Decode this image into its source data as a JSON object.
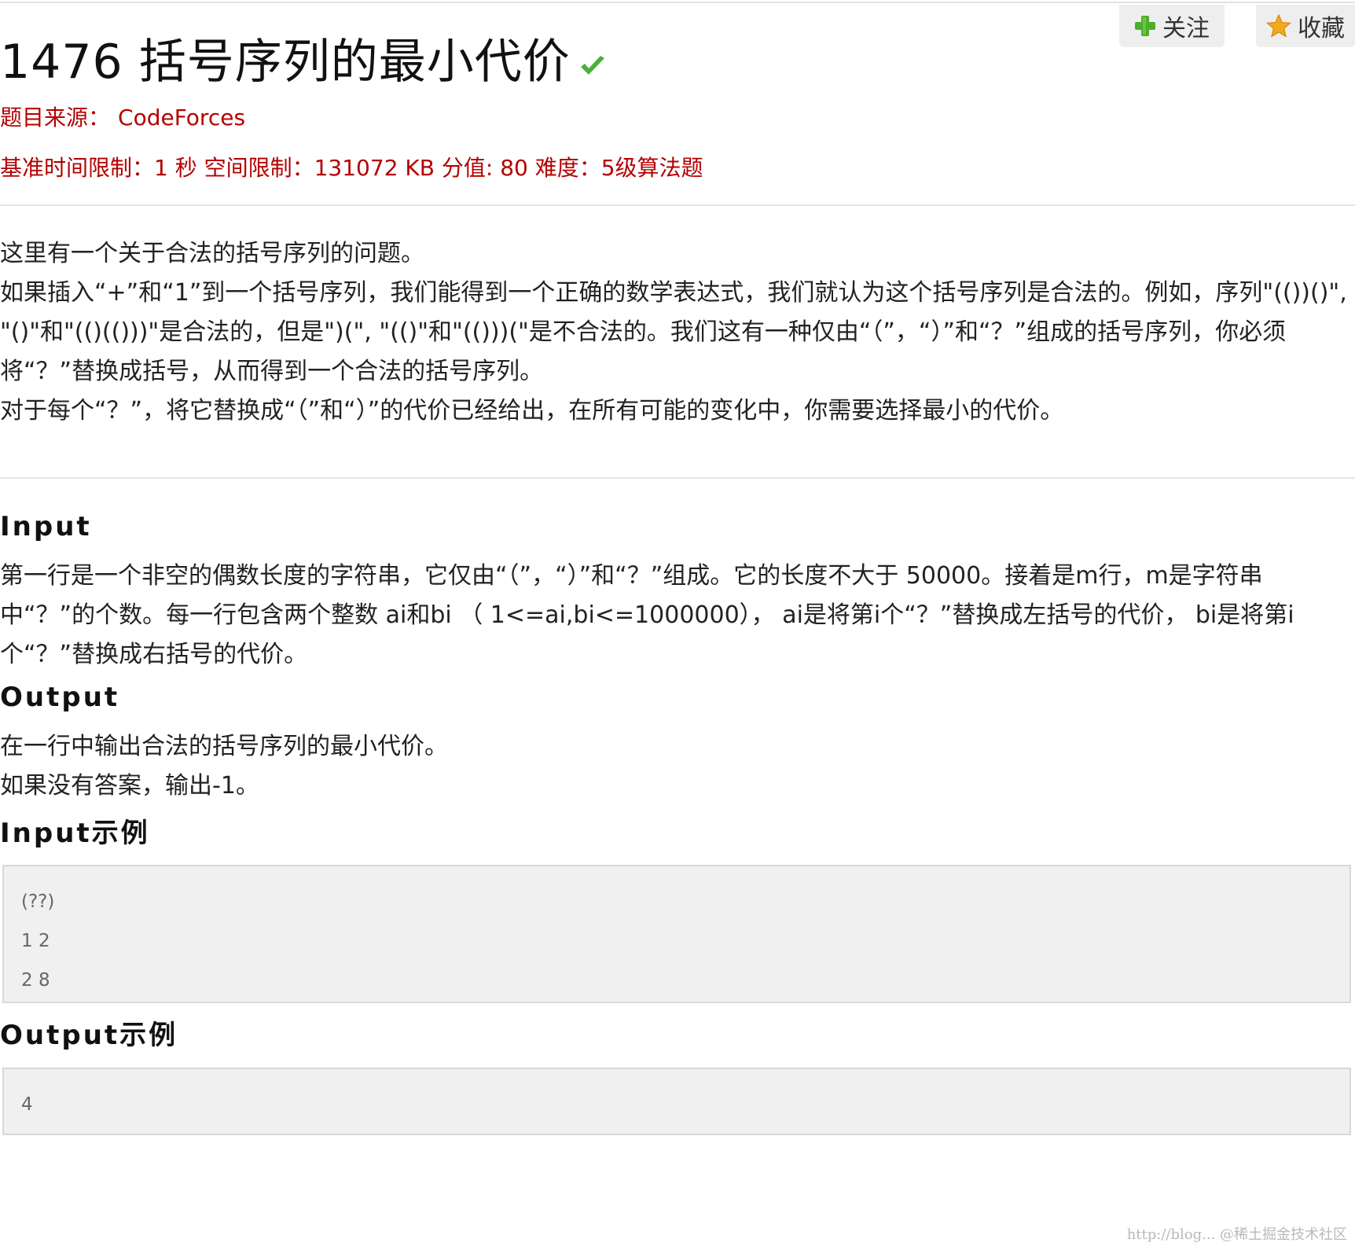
{
  "header": {
    "title": "1476 括号序列的最小代价",
    "follow_label": "关注",
    "favorite_label": "收藏"
  },
  "meta": {
    "source_label": "题目来源：",
    "source_value": "CodeForces",
    "limits": "基准时间限制：1 秒 空间限制：131072 KB 分值: 80 难度：5级算法题"
  },
  "description": {
    "lines": [
      "这里有一个关于合法的括号序列的问题。",
      "如果插入“+”和“1”到一个括号序列，我们能得到一个正确的数学表达式，我们就认为这个括号序列是合法的。例如，序列\"(())()\", \"()\"和\"(()(()))\"是合法的，但是\")(\", \"(()\"和\"(()))(\"是不合法的。我们这有一种仅由“（”，“）”和“？”组成的括号序列，你必须将“？”替换成括号，从而得到一个合法的括号序列。",
      "对于每个“？”，将它替换成“（”和“）”的代价已经给出，在所有可能的变化中，你需要选择最小的代价。"
    ]
  },
  "input_section": {
    "heading": "Input",
    "text": "第一行是一个非空的偶数长度的字符串，它仅由“（”，“）”和“？”组成。它的长度不大于 50000。接着是m行，m是字符串中“？”的个数。每一行包含两个整数 ai和bi （ 1<=ai,bi<=1000000）， ai是将第i个“？”替换成左括号的代价， bi是将第i个“？”替换成右括号的代价。"
  },
  "output_section": {
    "heading": "Output",
    "lines": [
      "在一行中输出合法的括号序列的最小代价。",
      "如果没有答案，输出-1。"
    ]
  },
  "input_example": {
    "heading": "Input示例",
    "lines": [
      "(??)",
      "1 2",
      "2 8"
    ]
  },
  "output_example": {
    "heading": "Output示例",
    "lines": [
      "4"
    ]
  },
  "watermark": "http://blog... @稀土掘金技术社区",
  "colors": {
    "meta_red": "#b40000",
    "plus_green": "#4caf2a",
    "star_gold": "#f2a91e",
    "check_green": "#4cae3d"
  }
}
